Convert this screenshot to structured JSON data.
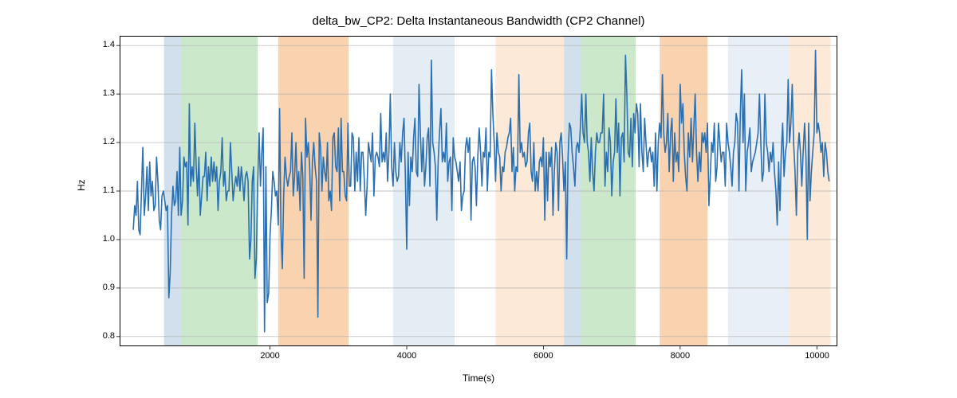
{
  "chart_data": {
    "type": "line",
    "title": "delta_bw_CP2: Delta Instantaneous Bandwidth (CP2 Channel)",
    "xlabel": "Time(s)",
    "ylabel": "Hz",
    "xlim": [
      -200,
      10300
    ],
    "ylim": [
      0.78,
      1.42
    ],
    "xticks": [
      2000,
      4000,
      6000,
      8000,
      10000
    ],
    "yticks": [
      0.8,
      0.9,
      1.0,
      1.1,
      1.2,
      1.3,
      1.4
    ],
    "x_step": 20,
    "values": [
      1.02,
      1.07,
      1.05,
      1.12,
      1.02,
      1.01,
      1.1,
      1.19,
      1.05,
      1.09,
      1.15,
      1.06,
      1.16,
      1.09,
      1.12,
      1.06,
      1.07,
      1.17,
      1.12,
      1.04,
      1.02,
      1.09,
      1.1,
      1.08,
      1.06,
      1.07,
      0.88,
      0.93,
      1.05,
      1.11,
      1.07,
      1.08,
      1.14,
      1.05,
      1.19,
      1.05,
      1.08,
      1.17,
      1.15,
      1.16,
      1.03,
      1.28,
      1.11,
      1.15,
      1.12,
      1.24,
      1.15,
      1.09,
      1.17,
      1.05,
      1.09,
      1.13,
      1.13,
      1.18,
      1.08,
      1.15,
      1.11,
      1.17,
      1.12,
      1.16,
      1.12,
      1.15,
      1.06,
      1.12,
      1.14,
      1.21,
      1.11,
      1.14,
      1.08,
      1.1,
      1.1,
      1.2,
      1.14,
      1.08,
      1.11,
      1.13,
      1.11,
      1.15,
      1.1,
      1.15,
      1.12,
      1.08,
      1.13,
      1.14,
      1.12,
      0.96,
      1.0,
      1.12,
      1.15,
      0.92,
      0.96,
      1.11,
      1.22,
      1.11,
      1.18,
      1.23,
      0.81,
      1.15,
      0.87,
      0.89,
      1.01,
      1.06,
      1.14,
      1.12,
      1.09,
      1.1,
      1.03,
      1.27,
      1.02,
      0.94,
      1.09,
      1.17,
      1.13,
      1.11,
      1.13,
      1.14,
      1.22,
      1.09,
      1.13,
      1.2,
      1.1,
      1.14,
      1.06,
      1.18,
      1.13,
      0.92,
      1.25,
      1.17,
      1.2,
      1.15,
      1.04,
      1.16,
      1.2,
      1.15,
      1.12,
      0.84,
      1.22,
      1.19,
      1.1,
      1.17,
      1.14,
      1.12,
      1.2,
      1.08,
      1.1,
      1.06,
      1.21,
      1.22,
      1.15,
      1.14,
      1.23,
      1.08,
      1.25,
      1.14,
      1.14,
      1.09,
      1.08,
      1.24,
      1.11,
      1.11,
      1.22,
      1.21,
      1.1,
      1.18,
      1.12,
      1.21,
      1.1,
      1.18,
      1.18,
      1.12,
      1.05,
      1.11,
      1.2,
      1.18,
      1.16,
      1.22,
      1.09,
      1.17,
      1.18,
      1.17,
      1.15,
      1.26,
      1.16,
      1.18,
      1.16,
      1.22,
      1.12,
      1.18,
      1.3,
      1.15,
      1.11,
      1.2,
      1.14,
      1.12,
      1.13,
      1.2,
      1.16,
      1.22,
      1.25,
      1.13,
      0.98,
      1.18,
      1.07,
      1.17,
      1.14,
      1.21,
      1.25,
      1.14,
      1.13,
      1.32,
      1.22,
      1.14,
      1.21,
      1.11,
      1.15,
      1.21,
      1.23,
      1.11,
      1.37,
      1.2,
      1.18,
      1.15,
      1.04,
      1.16,
      1.22,
      1.27,
      1.16,
      1.18,
      1.16,
      1.24,
      1.12,
      1.16,
      1.17,
      1.06,
      1.21,
      1.17,
      1.16,
      1.14,
      1.12,
      1.16,
      1.06,
      1.09,
      1.1,
      1.19,
      1.21,
      1.18,
      1.21,
      1.04,
      1.16,
      1.17,
      1.15,
      1.07,
      1.17,
      1.23,
      1.18,
      1.11,
      1.18,
      1.17,
      1.23,
      1.1,
      1.18,
      1.17,
      1.35,
      1.26,
      1.2,
      1.12,
      1.22,
      1.18,
      1.17,
      1.1,
      1.15,
      1.14,
      1.18,
      1.19,
      1.21,
      1.22,
      1.25,
      1.14,
      1.19,
      1.1,
      1.15,
      1.14,
      1.34,
      1.18,
      1.2,
      1.17,
      1.18,
      1.15,
      1.16,
      1.22,
      1.24,
      1.14,
      1.12,
      1.2,
      1.1,
      1.14,
      1.1,
      1.16,
      1.17,
      1.15,
      1.21,
      1.04,
      1.18,
      1.08,
      1.18,
      1.15,
      1.19,
      1.05,
      1.14,
      1.2,
      1.18,
      1.06,
      1.2,
      1.22,
      1.17,
      1.1,
      1.16,
      0.96,
      1.17,
      1.24,
      1.23,
      1.18,
      1.15,
      1.11,
      1.19,
      1.2,
      1.18,
      1.23,
      1.3,
      1.22,
      1.2,
      1.3,
      1.2,
      1.18,
      1.12,
      1.21,
      1.14,
      1.1,
      1.18,
      1.22,
      1.2,
      1.2,
      1.22,
      1.22,
      1.3,
      1.11,
      1.18,
      1.14,
      1.23,
      1.2,
      1.09,
      1.16,
      1.18,
      1.29,
      1.18,
      1.24,
      1.09,
      1.21,
      1.22,
      1.16,
      1.38,
      1.3,
      1.18,
      1.17,
      1.25,
      1.15,
      1.26,
      1.22,
      1.28,
      1.26,
      1.15,
      1.28,
      1.18,
      1.14,
      1.25,
      1.2,
      1.15,
      1.18,
      1.19,
      1.16,
      1.18,
      1.11,
      1.22,
      1.1,
      1.2,
      1.24,
      1.21,
      1.34,
      1.22,
      1.18,
      1.2,
      1.26,
      1.14,
      1.22,
      1.25,
      1.12,
      1.22,
      1.16,
      1.18,
      1.14,
      1.32,
      1.24,
      1.28,
      1.18,
      1.13,
      1.1,
      1.22,
      1.17,
      1.25,
      1.16,
      1.23,
      1.3,
      1.18,
      1.12,
      1.18,
      1.14,
      1.22,
      1.2,
      1.22,
      1.18,
      1.24,
      1.07,
      1.13,
      1.2,
      1.18,
      1.24,
      1.12,
      1.15,
      1.24,
      1.2,
      1.16,
      1.18,
      1.18,
      1.11,
      1.24,
      1.2,
      1.18,
      1.15,
      1.11,
      1.18,
      1.2,
      1.26,
      1.24,
      1.1,
      1.26,
      1.35,
      1.2,
      1.3,
      1.1,
      1.18,
      1.2,
      1.23,
      1.14,
      1.16,
      1.17,
      1.18,
      1.2,
      1.22,
      1.3,
      1.2,
      1.12,
      1.14,
      1.3,
      1.2,
      1.18,
      1.14,
      1.18,
      1.16,
      1.2,
      1.14,
      1.1,
      1.03,
      1.16,
      1.06,
      1.18,
      1.24,
      1.13,
      1.18,
      1.2,
      1.33,
      1.2,
      1.24,
      1.32,
      1.2,
      1.14,
      1.05,
      1.18,
      1.22,
      1.18,
      1.11,
      1.18,
      1.24,
      1.17,
      1.0,
      1.24,
      1.08,
      1.14,
      1.18,
      1.22,
      1.39,
      1.22,
      1.24,
      1.22,
      1.18,
      1.2,
      1.13,
      1.2,
      1.18,
      1.14,
      1.12
    ],
    "shading_regions": [
      {
        "x0": 450,
        "x1": 700,
        "color": "#b3cbe0",
        "alpha": 0.6
      },
      {
        "x0": 700,
        "x1": 1820,
        "color": "#a8d8a8",
        "alpha": 0.6
      },
      {
        "x0": 2120,
        "x1": 3150,
        "color": "#f5b57a",
        "alpha": 0.6
      },
      {
        "x0": 3800,
        "x1": 4700,
        "color": "#b3cbe0",
        "alpha": 0.35
      },
      {
        "x0": 5300,
        "x1": 6300,
        "color": "#f5b57a",
        "alpha": 0.3
      },
      {
        "x0": 6300,
        "x1": 6550,
        "color": "#b3cbe0",
        "alpha": 0.6
      },
      {
        "x0": 6550,
        "x1": 7350,
        "color": "#a8d8a8",
        "alpha": 0.6
      },
      {
        "x0": 7700,
        "x1": 8400,
        "color": "#f5b57a",
        "alpha": 0.6
      },
      {
        "x0": 8700,
        "x1": 9600,
        "color": "#b3cbe0",
        "alpha": 0.3
      },
      {
        "x0": 9600,
        "x1": 10200,
        "color": "#f5b57a",
        "alpha": 0.3
      }
    ],
    "line_color": "#2a6fb0"
  }
}
